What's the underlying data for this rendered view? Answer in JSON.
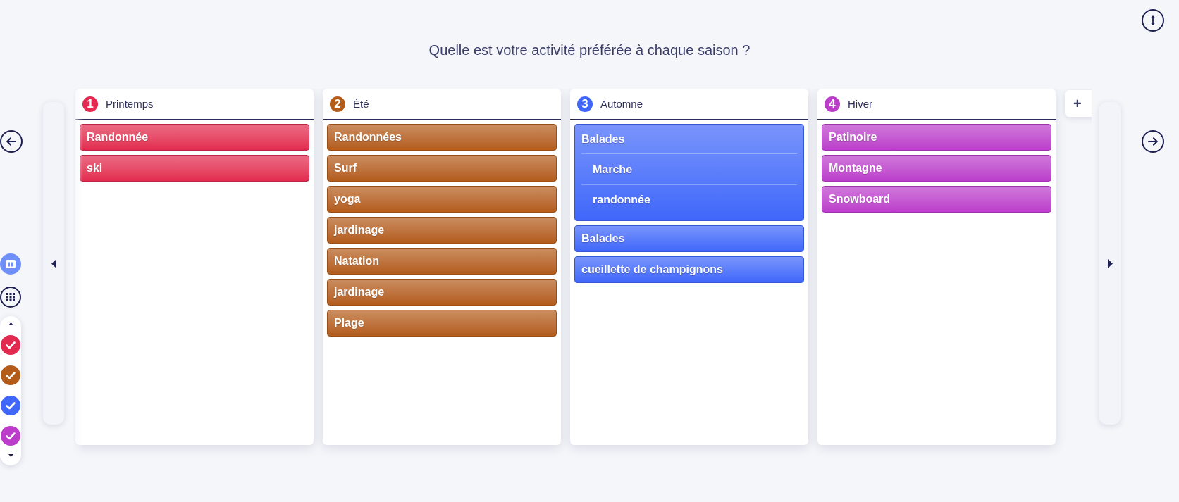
{
  "question": "Quelle est votre activité préférée à chaque saison ?",
  "view_modes": [
    {
      "kind": "columns",
      "selected": true
    },
    {
      "kind": "grid",
      "selected": false
    }
  ],
  "filters": [
    {
      "color": "#e2294f",
      "checked": true
    },
    {
      "color": "#b35c1a",
      "checked": true
    },
    {
      "color": "#4066fa",
      "checked": true
    },
    {
      "color": "#bb3dca",
      "checked": true
    }
  ],
  "columns": [
    {
      "number": "1",
      "title": "Printemps",
      "color": "#e2294f",
      "items": [
        {
          "label": "Randonnée"
        },
        {
          "label": "ski"
        }
      ]
    },
    {
      "number": "2",
      "title": "Été",
      "color": "#b35c1a",
      "items": [
        {
          "label": "Randonnées"
        },
        {
          "label": "Surf"
        },
        {
          "label": "yoga"
        },
        {
          "label": "jardinage"
        },
        {
          "label": "Natation"
        },
        {
          "label": "jardinage"
        },
        {
          "label": "Plage"
        }
      ]
    },
    {
      "number": "3",
      "title": "Automne",
      "color": "#4066fa",
      "items": [
        {
          "label": "Balades",
          "children": [
            {
              "label": "Marche"
            },
            {
              "label": "randonnée"
            }
          ]
        },
        {
          "label": "Balades"
        },
        {
          "label": "cueillette de champignons"
        }
      ]
    },
    {
      "number": "4",
      "title": "Hiver",
      "color": "#bb3dca",
      "items": [
        {
          "label": "Patinoire"
        },
        {
          "label": "Montagne"
        },
        {
          "label": "Snowboard"
        }
      ]
    }
  ],
  "add_column": {
    "label": "+"
  }
}
